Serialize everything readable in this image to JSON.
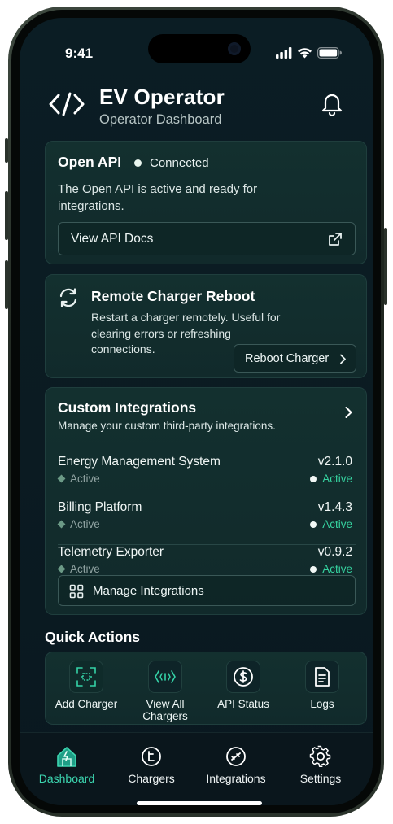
{
  "status_bar": {
    "time": "9:41"
  },
  "header": {
    "title": "EV Operator",
    "subtitle": "Operator Dashboard",
    "logo_icon": "code-brackets-icon",
    "notification_icon": "bell-icon"
  },
  "open_api": {
    "title": "Open API",
    "status": "Connected",
    "description": "The Open API is active and ready for integrations.",
    "docs_button": "View API Docs"
  },
  "reboot": {
    "title": "Remote Charger Reboot",
    "description": "Restart a charger remotely. Useful for clearing errors or refreshing connections.",
    "button": "Reboot Charger"
  },
  "integrations": {
    "title": "Custom Integrations",
    "subtitle": "Manage your custom third-party integrations.",
    "items": [
      {
        "name": "Energy Management System",
        "status": "Active",
        "version": "v2.1.0",
        "version_status": "Active"
      },
      {
        "name": "Billing Platform",
        "status": "Active",
        "version": "v1.4.3",
        "version_status": "Active"
      },
      {
        "name": "Telemetry Exporter",
        "status": "Active",
        "version": "v0.9.2",
        "version_status": "Active"
      }
    ],
    "manage_button": "Manage Integrations"
  },
  "quick_actions": {
    "title": "Quick Actions",
    "items": [
      {
        "label": "Add Charger",
        "icon": "scan-charger-icon"
      },
      {
        "label": "View All Chargers",
        "icon": "signal-charger-icon"
      },
      {
        "label": "API Status",
        "icon": "dollar-status-icon"
      },
      {
        "label": "Logs",
        "icon": "document-icon"
      }
    ]
  },
  "tabs": [
    {
      "label": "Dashboard",
      "icon": "home-icon",
      "active": true
    },
    {
      "label": "Chargers",
      "icon": "charger-gauge-icon",
      "active": false
    },
    {
      "label": "Integrations",
      "icon": "integrations-icon",
      "active": false
    },
    {
      "label": "Settings",
      "icon": "gear-icon",
      "active": false
    }
  ],
  "colors": {
    "accent": "#3cd6b0",
    "active_status": "#36d3a0",
    "background": "#0b1d24",
    "card": "#13302f"
  }
}
